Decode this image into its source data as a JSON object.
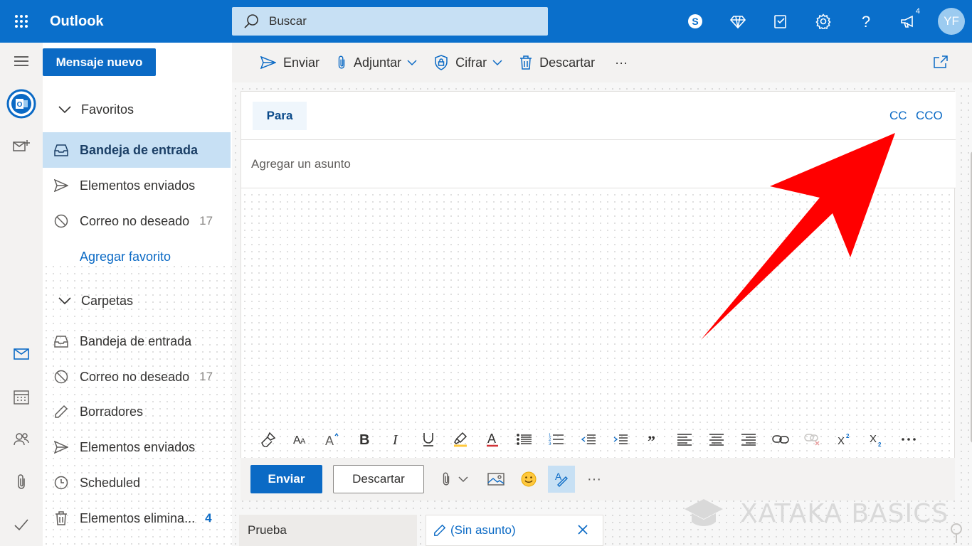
{
  "app": {
    "title": "Outlook"
  },
  "search": {
    "placeholder": "Buscar"
  },
  "topbar": {
    "notifications_count": "4",
    "avatar_initials": "YF"
  },
  "folders": {
    "new_message": "Mensaje nuevo",
    "favorites_header": "Favoritos",
    "favorites": [
      {
        "label": "Bandeja de entrada",
        "count": ""
      },
      {
        "label": "Elementos enviados",
        "count": ""
      },
      {
        "label": "Correo no deseado",
        "count": "17"
      }
    ],
    "add_favorite": "Agregar favorito",
    "folders_header": "Carpetas",
    "folders": [
      {
        "label": "Bandeja de entrada",
        "count": ""
      },
      {
        "label": "Correo no deseado",
        "count": "17"
      },
      {
        "label": "Borradores",
        "count": ""
      },
      {
        "label": "Elementos enviados",
        "count": ""
      },
      {
        "label": "Scheduled",
        "count": ""
      },
      {
        "label": "Elementos elimina...",
        "count": "4"
      }
    ]
  },
  "commandbar": {
    "send": "Enviar",
    "attach": "Adjuntar",
    "encrypt": "Cifrar",
    "discard": "Descartar",
    "more": "···"
  },
  "compose": {
    "to_button": "Para",
    "cc": "CC",
    "bcc": "CCO",
    "subject_placeholder": "Agregar un asunto"
  },
  "actions": {
    "send": "Enviar",
    "discard": "Descartar",
    "more": "···"
  },
  "tabs": {
    "prueba": "Prueba",
    "draft": "(Sin asunto)"
  },
  "watermark": {
    "text": "XATAKA BASICS"
  },
  "colors": {
    "brand_blue": "#0a6fcb",
    "selected_bg": "#c7e0f4",
    "arrow_red": "#ff0000"
  }
}
